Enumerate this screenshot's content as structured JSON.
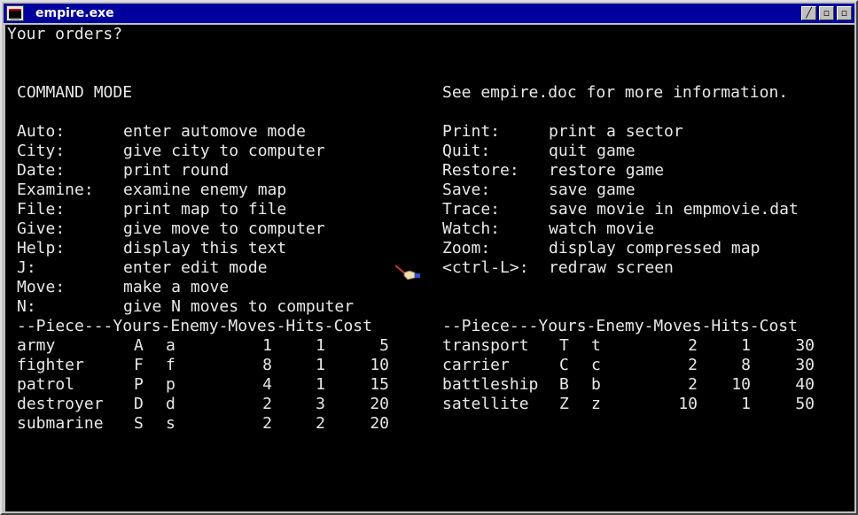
{
  "window": {
    "title": "empire.exe",
    "buttons": [
      "minimize-button",
      "maximize-button",
      "close-button"
    ]
  },
  "console": {
    "prompt": "Your orders?",
    "header_left": "COMMAND MODE",
    "header_right": "See empire.doc for more information.",
    "commands_left": [
      {
        "key": "Auto:",
        "desc": "enter automove mode"
      },
      {
        "key": "City:",
        "desc": "give city to computer"
      },
      {
        "key": "Date:",
        "desc": "print round"
      },
      {
        "key": "Examine:",
        "desc": "examine enemy map"
      },
      {
        "key": "File:",
        "desc": "print map to file"
      },
      {
        "key": "Give:",
        "desc": "give move to computer"
      },
      {
        "key": "Help:",
        "desc": "display this text"
      },
      {
        "key": "J:",
        "desc": "enter edit mode"
      },
      {
        "key": "Move:",
        "desc": "make a move"
      },
      {
        "key": "N:",
        "desc": "give N moves to computer"
      }
    ],
    "commands_right": [
      {
        "key": "Print:",
        "desc": "print a sector"
      },
      {
        "key": "Quit:",
        "desc": "quit game"
      },
      {
        "key": "Restore:",
        "desc": "restore game"
      },
      {
        "key": "Save:",
        "desc": "save game"
      },
      {
        "key": "Trace:",
        "desc": "save movie in empmovie.dat"
      },
      {
        "key": "Watch:",
        "desc": "watch movie"
      },
      {
        "key": "Zoom:",
        "desc": "display compressed map"
      },
      {
        "key": "<ctrl-L>:",
        "desc": "redraw screen"
      }
    ],
    "piece_header": "--Piece---Yours-Enemy-Moves-Hits-Cost",
    "pieces_left": [
      [
        "army",
        "A",
        "a",
        "1",
        "1",
        "5"
      ],
      [
        "fighter",
        "F",
        "f",
        "8",
        "1",
        "10"
      ],
      [
        "patrol",
        "P",
        "p",
        "4",
        "1",
        "15"
      ],
      [
        "destroyer",
        "D",
        "d",
        "2",
        "3",
        "20"
      ],
      [
        "submarine",
        "S",
        "s",
        "2",
        "2",
        "20"
      ]
    ],
    "pieces_right": [
      [
        "transport",
        "T",
        "t",
        "2",
        "1",
        "30"
      ],
      [
        "carrier",
        "C",
        "c",
        "2",
        "8",
        "30"
      ],
      [
        "battleship",
        "B",
        "b",
        "2",
        "10",
        "40"
      ],
      [
        "satellite",
        "Z",
        "z",
        "10",
        "1",
        "50"
      ]
    ]
  },
  "colors": {
    "titlebar": "#00009c",
    "console_bg": "#000000",
    "console_fg": "#e8e8e8"
  }
}
